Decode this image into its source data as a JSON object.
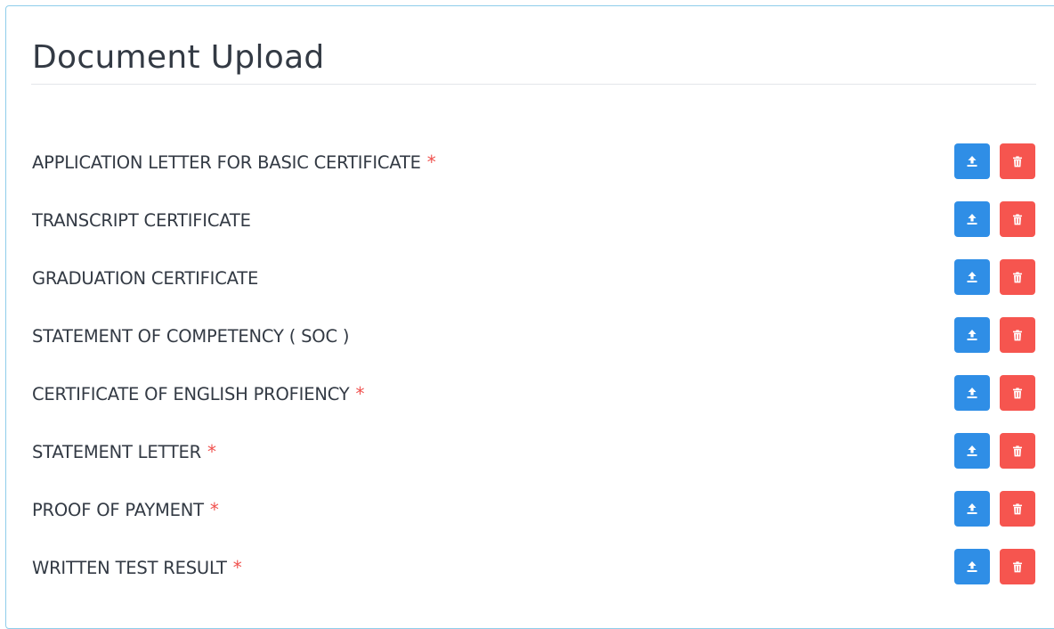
{
  "page": {
    "title": "Document Upload"
  },
  "colors": {
    "upload_button": "#2f8ee6",
    "delete_button": "#f6554f",
    "required_mark": "#f0524f",
    "panel_border": "#8ecdea",
    "text": "#333a44"
  },
  "icons": {
    "upload": "upload-icon",
    "delete": "trash-icon"
  },
  "documents": [
    {
      "label": "APPLICATION LETTER FOR BASIC CERTIFICATE",
      "required_mark": "*"
    },
    {
      "label": "TRANSCRIPT CERTIFICATE",
      "required_mark": ""
    },
    {
      "label": "GRADUATION CERTIFICATE",
      "required_mark": ""
    },
    {
      "label": "STATEMENT OF COMPETENCY ( SOC )",
      "required_mark": ""
    },
    {
      "label": "CERTIFICATE OF ENGLISH PROFIENCY",
      "required_mark": "*"
    },
    {
      "label": "STATEMENT LETTER",
      "required_mark": "*"
    },
    {
      "label": "PROOF OF PAYMENT",
      "required_mark": "*"
    },
    {
      "label": "WRITTEN TEST RESULT",
      "required_mark": "*"
    }
  ]
}
